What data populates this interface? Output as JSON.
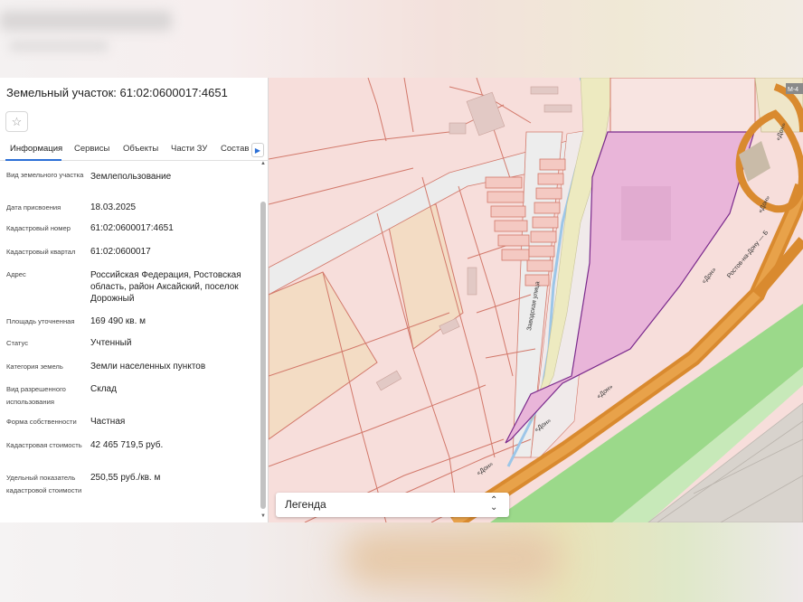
{
  "panel": {
    "title": "Земельный участок: 61:02:0600017:4651",
    "favorite_icon": "star-outline-icon",
    "tabs": [
      {
        "label": "Информация",
        "active": true
      },
      {
        "label": "Сервисы",
        "active": false
      },
      {
        "label": "Объекты",
        "active": false
      },
      {
        "label": "Части ЗУ",
        "active": false
      },
      {
        "label": "Состав",
        "active": false
      }
    ],
    "tabs_next_icon": "caret-right-icon",
    "rows": [
      {
        "label": "Вид земельного участка",
        "value": "Землепользование"
      },
      {
        "label": "Дата присвоения",
        "value": "18.03.2025"
      },
      {
        "label": "Кадастровый номер",
        "value": "61:02:0600017:4651"
      },
      {
        "label": "Кадастровый квартал",
        "value": "61:02:0600017"
      },
      {
        "label": "Адрес",
        "value": "Российская Федерация, Ростовская область, район Аксайский, поселок Дорожный"
      },
      {
        "label": "Площадь уточненная",
        "value": "169 490 кв. м"
      },
      {
        "label": "Статус",
        "value": "Учтенный"
      },
      {
        "label": "Категория земель",
        "value": "Земли населенных пунктов"
      },
      {
        "label": "Вид разрешенного использования",
        "value": "Склад"
      },
      {
        "label": "Форма собственности",
        "value": "Частная"
      },
      {
        "label": "Кадастровая стоимость",
        "value": "42 465 719,5 руб."
      },
      {
        "label": "Удельный показатель кадастровой стоимости",
        "value": "250,55 руб./кв. м"
      }
    ]
  },
  "map": {
    "road_labels": [
      "«Дон»",
      "«Дон»",
      "«Дон»",
      "«Дон»",
      "«Дон»",
      "«Дон»",
      "Ростов-на-Дону — Б",
      "М-4"
    ],
    "street_label": "Заводская улица",
    "legend_label": "Легенда",
    "legend_toggle_icon": "chevron-up-down-icon",
    "colors": {
      "parcel_fill": "#f7dedb",
      "parcel_border": "#d2786a",
      "selected_parcel": "#e9b5d9",
      "selected_border": "#7a2a8c",
      "highway": "#d98a2f",
      "green": "#9bd98a"
    }
  }
}
